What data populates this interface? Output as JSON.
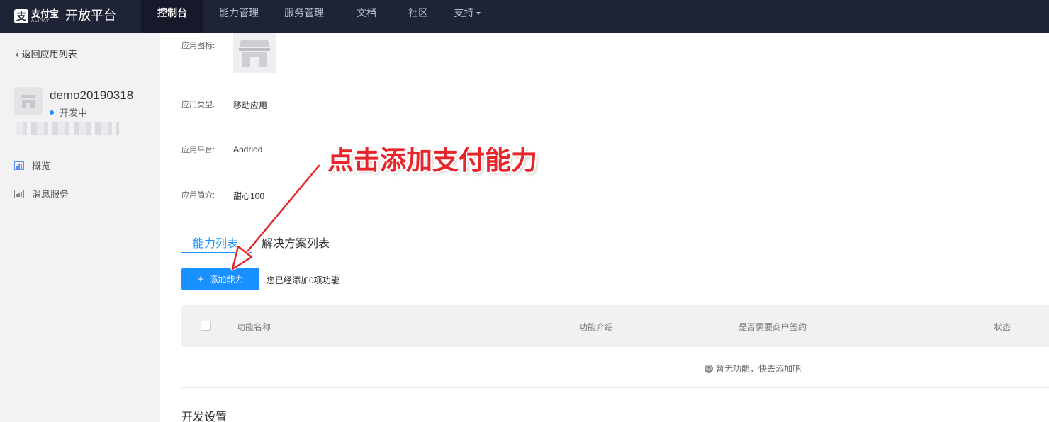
{
  "brand": {
    "logo_mark": "支",
    "logo_cn": "支付宝",
    "logo_en": "ALIPAY",
    "platform": "开放平台"
  },
  "nav": {
    "items": [
      {
        "label": "控制台",
        "active": true
      },
      {
        "label": "能力管理"
      },
      {
        "label": "服务管理"
      },
      {
        "label": "文档"
      },
      {
        "label": "社区"
      },
      {
        "label": "支持"
      }
    ]
  },
  "sidebar": {
    "back_label": "返回应用列表",
    "app_name": "demo20190318",
    "app_status": "开发中",
    "menu": [
      {
        "label": "概览",
        "icon": "chart-icon"
      },
      {
        "label": "消息服务",
        "icon": "chart-icon"
      }
    ]
  },
  "fields": {
    "icon_label": "应用图标:",
    "type_label": "应用类型:",
    "type_value": "移动应用",
    "platform_label": "应用平台:",
    "platform_value": "Andriod",
    "intro_label": "应用简介:",
    "intro_value": "甜心100"
  },
  "tabs": [
    {
      "label": "能力列表",
      "active": true
    },
    {
      "label": "解决方案列表"
    }
  ],
  "actions": {
    "add_plus": "+",
    "add_label": "添加能力",
    "added_note": "您已经添加0项功能"
  },
  "table": {
    "headers": [
      "功能名称",
      "功能介绍",
      "是否需要商户签约",
      "状态"
    ],
    "empty_text": "暂无功能，快去添加吧"
  },
  "section_title": "开发设置",
  "annotation": {
    "callout": "点击添加支付能力",
    "color": "#e6262b"
  },
  "colors": {
    "nav_bg": "#1e2336",
    "accent": "#1890ff",
    "sidebar_bg": "#f2f2f5"
  }
}
